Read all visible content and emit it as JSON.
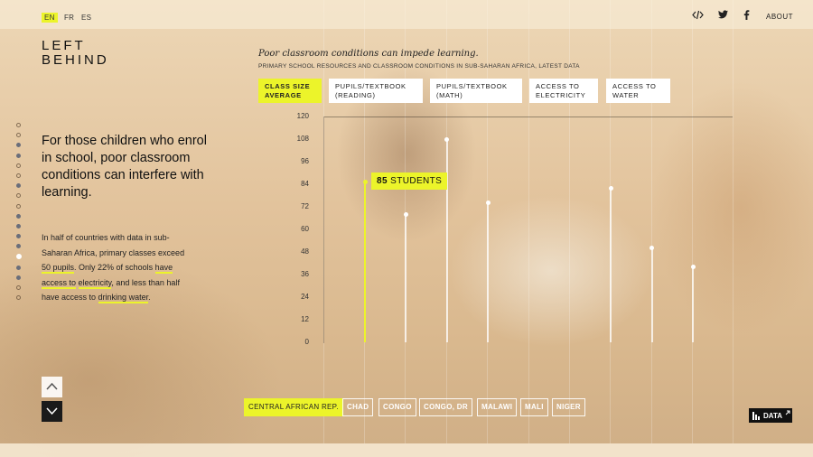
{
  "languages": [
    {
      "code": "EN",
      "active": true
    },
    {
      "code": "FR",
      "active": false
    },
    {
      "code": "ES",
      "active": false
    }
  ],
  "header": {
    "embed_icon": "embed-code-icon",
    "twitter_icon": "twitter-icon",
    "facebook_icon": "facebook-icon",
    "about_label": "ABOUT"
  },
  "logo": {
    "line1": "LEFT",
    "line2": "BEHIND"
  },
  "story": {
    "headline": "For those children who enrol in school, poor classroom conditions can interfere with learning.",
    "body": {
      "p1": "In half of countries with data in sub-Saharan Africa, primary classes exceed ",
      "link1": "50 pupils",
      "p2": ". Only 22% of schools ",
      "link2a": "have access to",
      "p3": " ",
      "link2b": "electricity",
      "p4": ", and less than half have access to ",
      "link3": "drinking water",
      "p5": "."
    },
    "progress": {
      "total": 18,
      "current": 13,
      "filled": [
        2,
        3,
        6,
        9,
        10,
        11,
        12,
        14,
        15
      ]
    }
  },
  "chart_data": {
    "type": "lollipop",
    "title": "Poor classroom conditions can impede learning.",
    "subtitle": "PRIMARY SCHOOL RESOURCES AND CLASSROOM CONDITIONS IN SUB-SAHARAN AFRICA, LATEST DATA",
    "tabs": [
      {
        "label": "CLASS SIZE AVERAGE",
        "active": true
      },
      {
        "label": "PUPILS/TEXTBOOK (READING)",
        "active": false
      },
      {
        "label": "PUPILS/TEXTBOOK (MATH)",
        "active": false
      },
      {
        "label": "ACCESS TO ELECTRICITY",
        "active": false
      },
      {
        "label": "ACCESS TO WATER",
        "active": false
      }
    ],
    "yticks": [
      "120",
      "108",
      "96",
      "84",
      "72",
      "60",
      "48",
      "36",
      "24",
      "12",
      "0"
    ],
    "ylim": [
      0,
      120
    ],
    "values": [
      85,
      68,
      108,
      74,
      null,
      null,
      82,
      50,
      40
    ],
    "highlight_index": 0,
    "highlight_label": "85 STUDENTS",
    "highlight_number": "85",
    "highlight_unit": "STUDENTS"
  },
  "countries": [
    {
      "label": "CENTRAL AFRICAN REP.",
      "active": true
    },
    {
      "label": "CHAD",
      "active": false
    },
    {
      "label": "CONGO",
      "active": false
    },
    {
      "label": "CONGO, DR",
      "active": false
    },
    {
      "label": "MALAWI",
      "active": false
    },
    {
      "label": "MALI",
      "active": false
    },
    {
      "label": "NIGER",
      "active": false
    }
  ],
  "data_button": {
    "label": "DATA"
  },
  "colors": {
    "accent": "#ecf42a",
    "dark": "#111111"
  }
}
